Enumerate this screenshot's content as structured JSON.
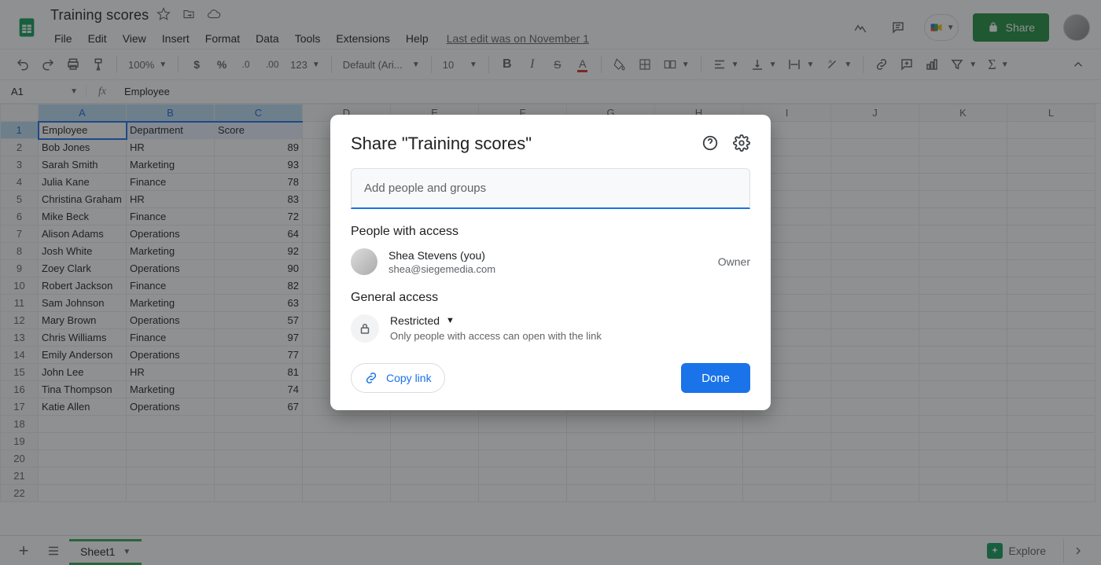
{
  "doc_title": "Training scores",
  "menus": [
    "File",
    "Edit",
    "View",
    "Insert",
    "Format",
    "Data",
    "Tools",
    "Extensions",
    "Help"
  ],
  "last_edit": "Last edit was on November 1",
  "share_button": "Share",
  "toolbar": {
    "zoom": "100%",
    "font": "Default (Ari...",
    "font_size": "10"
  },
  "cell_ref": "A1",
  "fx_value": "Employee",
  "columns": [
    "A",
    "B",
    "C",
    "D",
    "E",
    "F",
    "G",
    "H",
    "I",
    "J",
    "K",
    "L"
  ],
  "rows": 22,
  "selected_row": 1,
  "selected_cols": [
    "A",
    "B",
    "C"
  ],
  "data_rows": [
    {
      "a": "Employee",
      "b": "Department",
      "c": "Score",
      "c_align": "left"
    },
    {
      "a": "Bob Jones",
      "b": "HR",
      "c": "89"
    },
    {
      "a": "Sarah Smith",
      "b": "Marketing",
      "c": "93"
    },
    {
      "a": "Julia Kane",
      "b": "Finance",
      "c": "78"
    },
    {
      "a": "Christina Graham",
      "b": "HR",
      "c": "83"
    },
    {
      "a": "Mike Beck",
      "b": "Finance",
      "c": "72"
    },
    {
      "a": "Alison Adams",
      "b": "Operations",
      "c": "64"
    },
    {
      "a": "Josh White",
      "b": "Marketing",
      "c": "92"
    },
    {
      "a": "Zoey Clark",
      "b": "Operations",
      "c": "90"
    },
    {
      "a": "Robert Jackson",
      "b": "Finance",
      "c": "82"
    },
    {
      "a": "Sam Johnson",
      "b": "Marketing",
      "c": "63"
    },
    {
      "a": "Mary Brown",
      "b": "Operations",
      "c": "57"
    },
    {
      "a": "Chris Williams",
      "b": "Finance",
      "c": "97"
    },
    {
      "a": "Emily Anderson",
      "b": "Operations",
      "c": "77"
    },
    {
      "a": "John Lee",
      "b": "HR",
      "c": "81"
    },
    {
      "a": "Tina Thompson",
      "b": "Marketing",
      "c": "74"
    },
    {
      "a": "Katie Allen",
      "b": "Operations",
      "c": "67"
    }
  ],
  "sheet_tab": "Sheet1",
  "explore": "Explore",
  "dialog": {
    "title": "Share \"Training scores\"",
    "input_placeholder": "Add people and groups",
    "people_heading": "People with access",
    "person_name": "Shea Stevens (you)",
    "person_email": "shea@siegemedia.com",
    "owner": "Owner",
    "general_heading": "General access",
    "restricted_label": "Restricted",
    "restricted_desc": "Only people with access can open with the link",
    "copy_link": "Copy link",
    "done": "Done"
  }
}
